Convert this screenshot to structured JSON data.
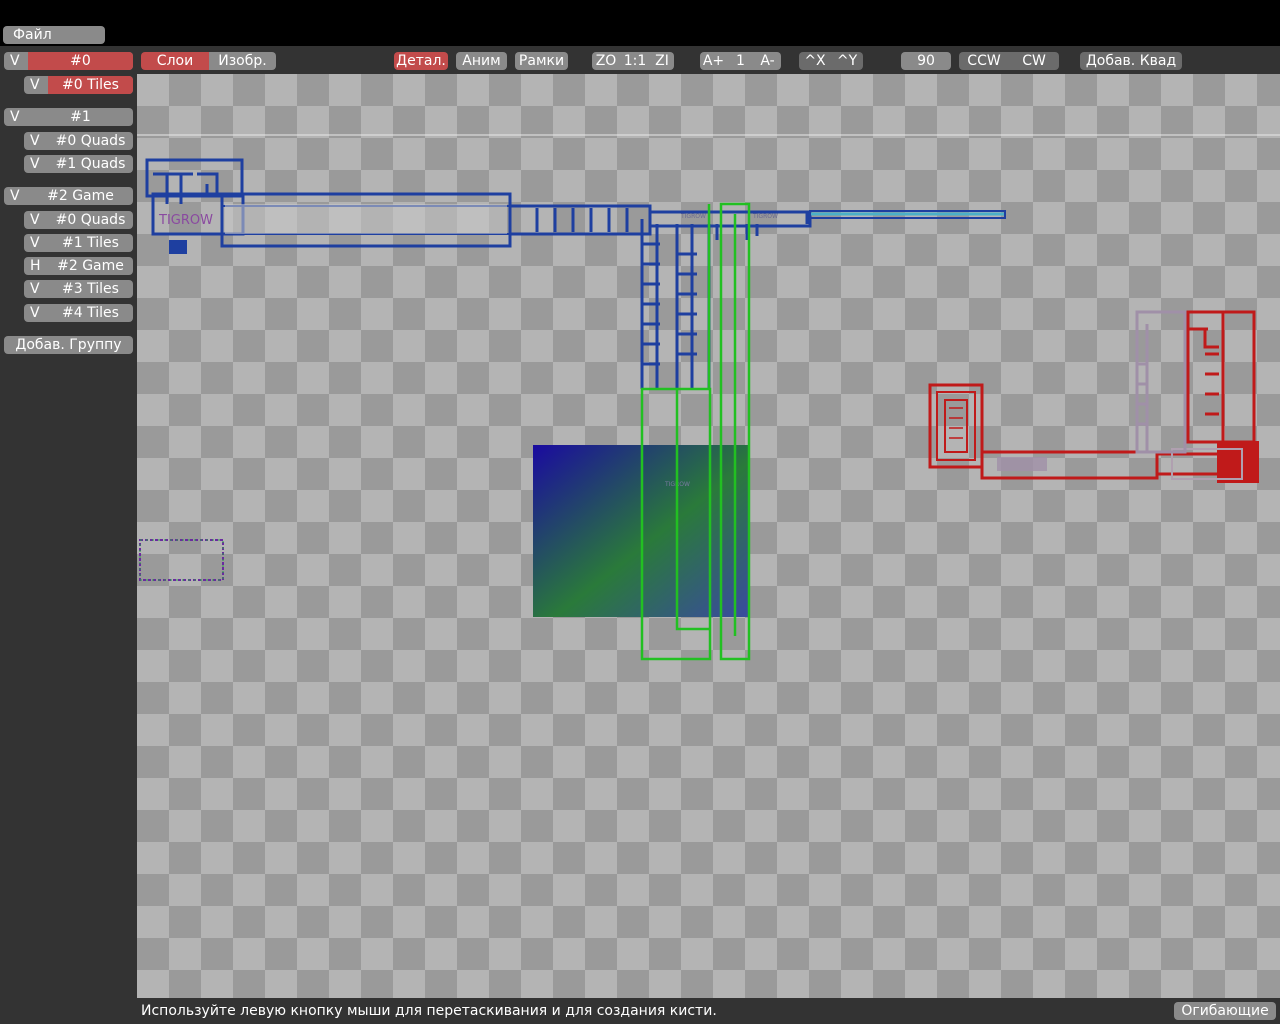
{
  "menu": {
    "file": "Файл"
  },
  "layers": {
    "groups": [
      {
        "vis": "V",
        "name": "#0",
        "selected": true,
        "layers": [
          {
            "vis": "V",
            "name": "#0 Tiles",
            "selected": true
          }
        ]
      },
      {
        "vis": "V",
        "name": "#1",
        "selected": false,
        "layers": [
          {
            "vis": "V",
            "name": "#0 Quads"
          },
          {
            "vis": "V",
            "name": "#1 Quads"
          }
        ]
      },
      {
        "vis": "V",
        "name": "#2 Game",
        "selected": false,
        "layers": [
          {
            "vis": "V",
            "name": "#0 Quads"
          },
          {
            "vis": "V",
            "name": "#1 Tiles"
          },
          {
            "vis": "H",
            "name": "#2 Game"
          },
          {
            "vis": "V",
            "name": "#3 Tiles"
          },
          {
            "vis": "V",
            "name": "#4 Tiles"
          }
        ]
      }
    ],
    "add_group": "Добав. Группу"
  },
  "toolbar": {
    "tab_layers": "Слои",
    "tab_images": "Изобр.",
    "detail": "Детал.",
    "anim": "Аним",
    "frames": "Рамки",
    "zoom_out": "ZO",
    "zoom_reset": "1:1",
    "zoom_in": "ZI",
    "anim_faster": "A+",
    "anim_speed": "1",
    "anim_slower": "A-",
    "flip_x": "^X",
    "flip_y": "^Y",
    "rotation": "90",
    "ccw": "CCW",
    "cw": "CW",
    "add_quad": "Добав. Квад"
  },
  "canvas": {
    "tee_label_1": "TIGROW",
    "tee_label_2": "TIGROW",
    "tee_label_3": "TIGROW",
    "tee_label_4": "TIGROW"
  },
  "status": {
    "text": "Используйте левую кнопку мыши для перетаскивания и для создания кисти.",
    "envelopes": "Огибающие"
  },
  "colors": {
    "accent": "#c24b4b",
    "button": "#8a8a8a",
    "panel": "#333333",
    "blue_layer": "#1e3fa0",
    "green_layer": "#22c022",
    "red_layer": "#c01a1a"
  }
}
